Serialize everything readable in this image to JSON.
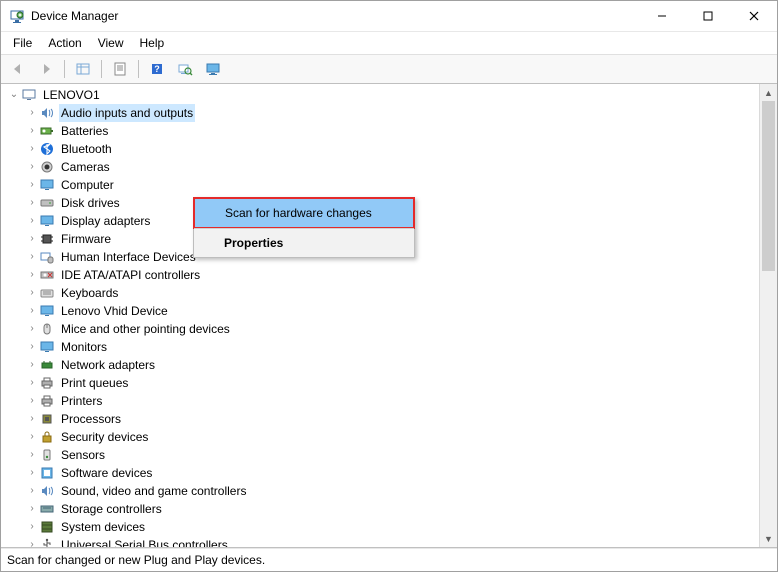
{
  "window": {
    "title": "Device Manager"
  },
  "menu": {
    "file": "File",
    "action": "Action",
    "view": "View",
    "help": "Help"
  },
  "root": {
    "label": "LENOVO1"
  },
  "categories": [
    {
      "label": "Audio inputs and outputs",
      "icon": "speaker",
      "selected": true
    },
    {
      "label": "Batteries",
      "icon": "battery"
    },
    {
      "label": "Bluetooth",
      "icon": "bluetooth"
    },
    {
      "label": "Cameras",
      "icon": "camera"
    },
    {
      "label": "Computer",
      "icon": "monitor"
    },
    {
      "label": "Disk drives",
      "icon": "disk"
    },
    {
      "label": "Display adapters",
      "icon": "monitor"
    },
    {
      "label": "Firmware",
      "icon": "chip"
    },
    {
      "label": "Human Interface Devices",
      "icon": "hid"
    },
    {
      "label": "IDE ATA/ATAPI controllers",
      "icon": "ide"
    },
    {
      "label": "Keyboards",
      "icon": "keyboard"
    },
    {
      "label": "Lenovo Vhid Device",
      "icon": "monitor"
    },
    {
      "label": "Mice and other pointing devices",
      "icon": "mouse"
    },
    {
      "label": "Monitors",
      "icon": "monitor"
    },
    {
      "label": "Network adapters",
      "icon": "network"
    },
    {
      "label": "Print queues",
      "icon": "printer"
    },
    {
      "label": "Printers",
      "icon": "printer"
    },
    {
      "label": "Processors",
      "icon": "cpu"
    },
    {
      "label": "Security devices",
      "icon": "lock"
    },
    {
      "label": "Sensors",
      "icon": "sensor"
    },
    {
      "label": "Software devices",
      "icon": "software"
    },
    {
      "label": "Sound, video and game controllers",
      "icon": "speaker"
    },
    {
      "label": "Storage controllers",
      "icon": "storage"
    },
    {
      "label": "System devices",
      "icon": "system"
    },
    {
      "label": "Universal Serial Bus controllers",
      "icon": "usb"
    }
  ],
  "context": {
    "scan": "Scan for hardware changes",
    "properties": "Properties"
  },
  "status": "Scan for changed or new Plug and Play devices."
}
